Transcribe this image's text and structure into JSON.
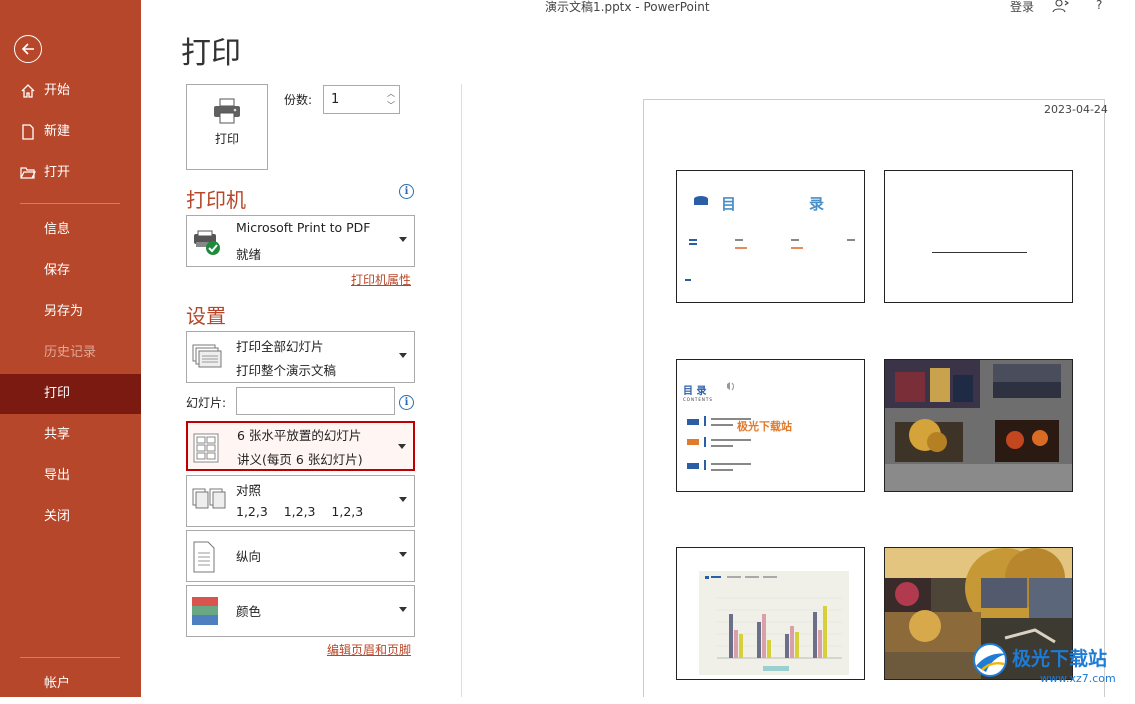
{
  "window": {
    "doc_title": "演示文稿1.pptx  -  PowerPoint",
    "login_label": "登录",
    "help_label": "?"
  },
  "sidebar": {
    "top_items": [
      {
        "label": "开始",
        "icon": "home-icon"
      },
      {
        "label": "新建",
        "icon": "new-file-icon"
      },
      {
        "label": "打开",
        "icon": "folder-open-icon"
      }
    ],
    "items": [
      {
        "label": "信息"
      },
      {
        "label": "保存"
      },
      {
        "label": "另存为"
      },
      {
        "label": "历史记录",
        "disabled": true
      },
      {
        "label": "打印",
        "active": true
      },
      {
        "label": "共享"
      },
      {
        "label": "导出"
      },
      {
        "label": "关闭"
      }
    ],
    "account_label": "帐户"
  },
  "page_heading": "打印",
  "print_button": {
    "label": "打印"
  },
  "copies": {
    "label": "份数:",
    "value": "1"
  },
  "printer": {
    "heading": "打印机",
    "name": "Microsoft Print to PDF",
    "status": "就绪",
    "properties_link": "打印机属性"
  },
  "settings": {
    "heading": "设置",
    "print_range": {
      "line1": "打印全部幻灯片",
      "line2": "打印整个演示文稿"
    },
    "slides_label": "幻灯片:",
    "slides_value": "",
    "layout": {
      "line1": "6 张水平放置的幻灯片",
      "line2": "讲义(每页 6 张幻灯片)"
    },
    "collate": {
      "line1": "对照",
      "line2": "1,2,3    1,2,3    1,2,3"
    },
    "orientation": {
      "label": "纵向"
    },
    "color": {
      "label": "颜色"
    },
    "header_footer_link": "编辑页眉和页脚"
  },
  "preview": {
    "date": "2023-04-24",
    "slide1": {
      "title_left": "目",
      "title_right": "录"
    },
    "slide3": {
      "title": "目 录",
      "subtitle": "CONTENTS",
      "overlay": "极光下载站"
    }
  },
  "watermark": {
    "text": "极光下载站",
    "url": "www.xz7.com"
  },
  "colors": {
    "brand": "#b7472a",
    "active_nav": "#7b1a10",
    "highlight_border": "#c00000"
  }
}
